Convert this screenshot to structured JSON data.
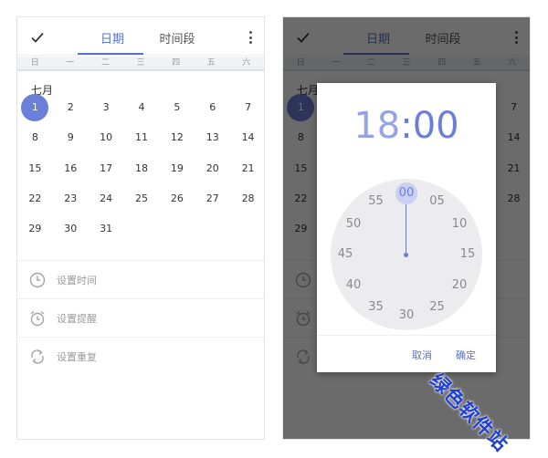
{
  "colors": {
    "accent": "#5a72c8",
    "selected_day": "#6b7fd8",
    "week_bar": "#f1f2f6",
    "overlay": "rgba(0,0,0,0.58)",
    "clock_face": "#ececee"
  },
  "toolbar": {
    "confirm_icon": "checkmark-icon",
    "tabs": [
      "日期",
      "时间段"
    ],
    "active_tab": "日期",
    "more_icon": "more-vertical-icon"
  },
  "weekdays": [
    "日",
    "一",
    "二",
    "三",
    "四",
    "五",
    "六"
  ],
  "month_label": "七月",
  "calendar": {
    "first_weekday_index": 0,
    "days": [
      "1",
      "2",
      "3",
      "4",
      "5",
      "6",
      "7",
      "8",
      "9",
      "10",
      "11",
      "12",
      "13",
      "14",
      "15",
      "16",
      "17",
      "18",
      "19",
      "20",
      "21",
      "22",
      "23",
      "24",
      "25",
      "26",
      "27",
      "28",
      "29",
      "30",
      "31"
    ],
    "selected_day": "1"
  },
  "options": [
    {
      "label": "设置时间",
      "icon": "clock-icon"
    },
    {
      "label": "设置提醒",
      "icon": "alarm-icon"
    },
    {
      "label": "设置重复",
      "icon": "repeat-icon"
    }
  ],
  "time_picker": {
    "hour": "18",
    "separator": ":",
    "minute": "00",
    "minute_ticks": [
      "00",
      "05",
      "10",
      "15",
      "20",
      "25",
      "30",
      "35",
      "40",
      "45",
      "50",
      "55"
    ],
    "selected_minute": "00",
    "cancel_label": "取消",
    "ok_label": "确定"
  },
  "watermark": "绿色软件站"
}
